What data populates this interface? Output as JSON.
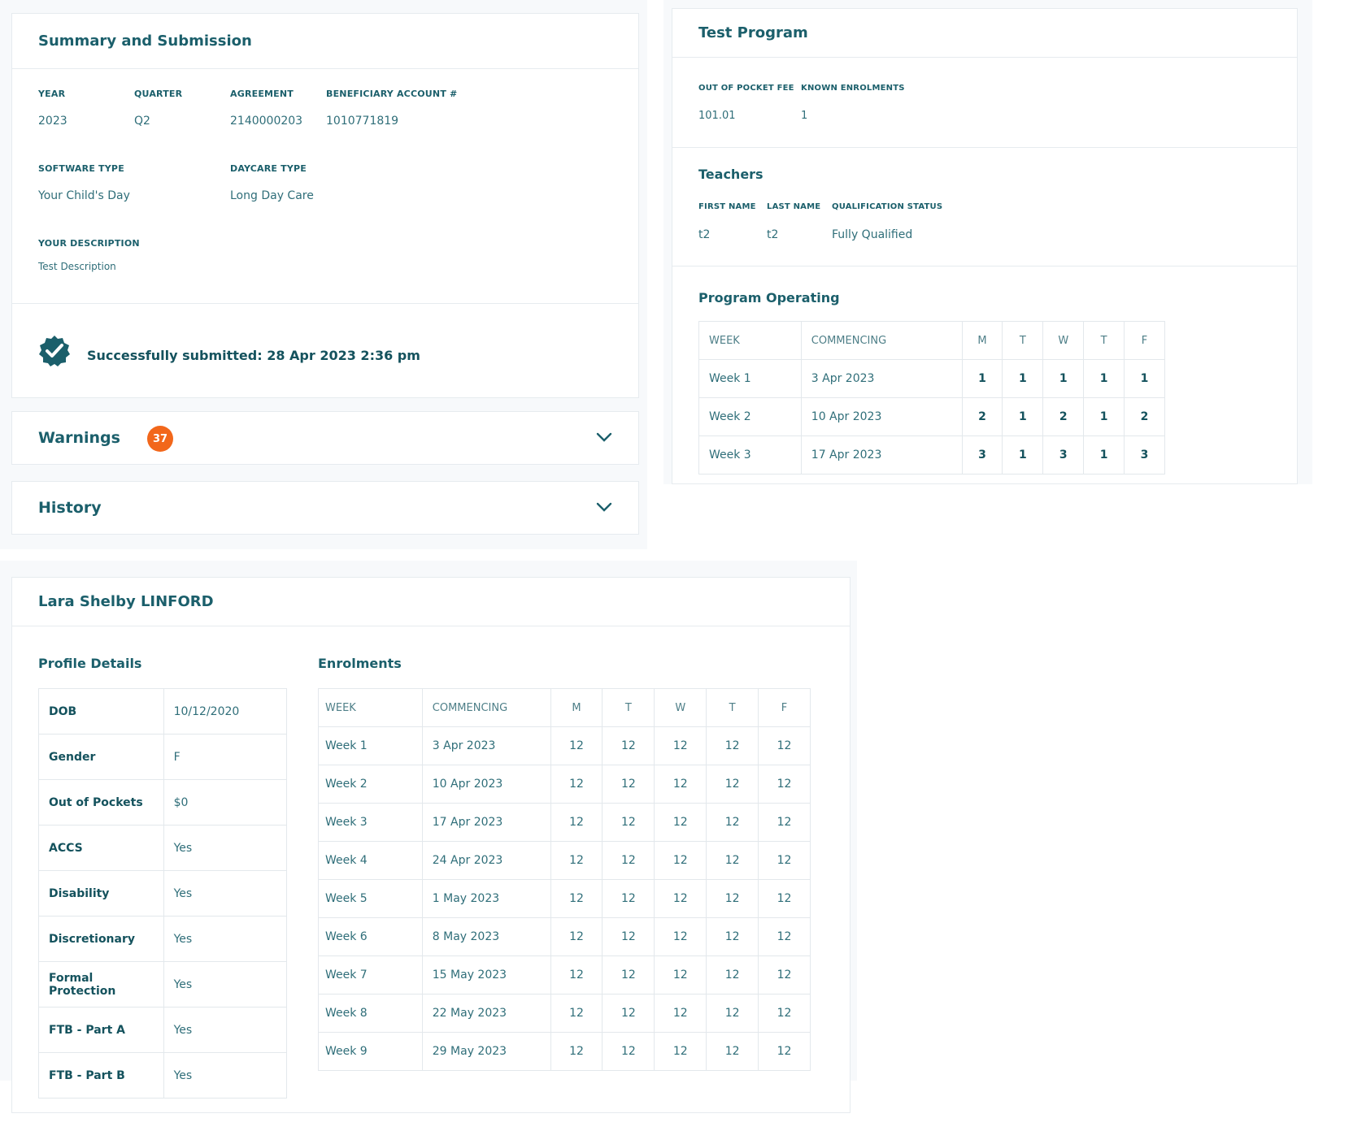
{
  "summary": {
    "title": "Summary and Submission",
    "fields": {
      "year_label": "YEAR",
      "year": "2023",
      "quarter_label": "QUARTER",
      "quarter": "Q2",
      "agreement_label": "AGREEMENT",
      "agreement": "2140000203",
      "beneficiary_label": "BENEFICIARY ACCOUNT #",
      "beneficiary": "1010771819",
      "software_label": "SOFTWARE TYPE",
      "software": "Your Child's Day",
      "daycare_label": "DAYCARE TYPE",
      "daycare": "Long Day Care",
      "description_label": "YOUR DESCRIPTION",
      "description": "Test Description"
    },
    "submitted_text": "Successfully submitted: 28 Apr 2023 2:36 pm",
    "success_icon": "verified-badge-icon"
  },
  "warnings": {
    "label": "Warnings",
    "count": "37"
  },
  "history": {
    "label": "History"
  },
  "program": {
    "title": "Test Program",
    "fee_label": "OUT OF POCKET FEE",
    "fee": "101.01",
    "enrol_label": "KNOWN ENROLMENTS",
    "enrol": "1",
    "teachers_title": "Teachers",
    "teacher_headers": [
      "FIRST NAME",
      "LAST NAME",
      "QUALIFICATION STATUS"
    ],
    "teacher": {
      "first": "t2",
      "last": "t2",
      "status": "Fully Qualified"
    },
    "operating_title": "Program Operating",
    "headers": [
      "WEEK",
      "COMMENCING",
      "M",
      "T",
      "W",
      "T",
      "F"
    ],
    "rows": [
      {
        "week": "Week 1",
        "commencing": "3 Apr 2023",
        "days": [
          "1",
          "1",
          "1",
          "1",
          "1"
        ]
      },
      {
        "week": "Week 2",
        "commencing": "10 Apr 2023",
        "days": [
          "2",
          "1",
          "2",
          "1",
          "2"
        ]
      },
      {
        "week": "Week 3",
        "commencing": "17 Apr 2023",
        "days": [
          "3",
          "1",
          "3",
          "1",
          "3"
        ]
      }
    ]
  },
  "child": {
    "name": "Lara Shelby LINFORD",
    "profile_title": "Profile Details",
    "profile": [
      {
        "k": "DOB",
        "v": "10/12/2020"
      },
      {
        "k": "Gender",
        "v": "F"
      },
      {
        "k": "Out of Pockets",
        "v": "$0"
      },
      {
        "k": "ACCS",
        "v": "Yes"
      },
      {
        "k": "Disability",
        "v": "Yes"
      },
      {
        "k": "Discretionary",
        "v": "Yes"
      },
      {
        "k": "Formal Protection",
        "v": "Yes"
      },
      {
        "k": "FTB - Part A",
        "v": "Yes"
      },
      {
        "k": "FTB - Part B",
        "v": "Yes"
      }
    ],
    "enrolments_title": "Enrolments",
    "headers": [
      "WEEK",
      "COMMENCING",
      "M",
      "T",
      "W",
      "T",
      "F"
    ],
    "rows": [
      {
        "week": "Week 1",
        "commencing": "3 Apr 2023",
        "days": [
          "12",
          "12",
          "12",
          "12",
          "12"
        ]
      },
      {
        "week": "Week 2",
        "commencing": "10 Apr 2023",
        "days": [
          "12",
          "12",
          "12",
          "12",
          "12"
        ]
      },
      {
        "week": "Week 3",
        "commencing": "17 Apr 2023",
        "days": [
          "12",
          "12",
          "12",
          "12",
          "12"
        ]
      },
      {
        "week": "Week 4",
        "commencing": "24 Apr 2023",
        "days": [
          "12",
          "12",
          "12",
          "12",
          "12"
        ]
      },
      {
        "week": "Week 5",
        "commencing": "1 May 2023",
        "days": [
          "12",
          "12",
          "12",
          "12",
          "12"
        ]
      },
      {
        "week": "Week 6",
        "commencing": "8 May 2023",
        "days": [
          "12",
          "12",
          "12",
          "12",
          "12"
        ]
      },
      {
        "week": "Week 7",
        "commencing": "15 May 2023",
        "days": [
          "12",
          "12",
          "12",
          "12",
          "12"
        ]
      },
      {
        "week": "Week 8",
        "commencing": "22 May 2023",
        "days": [
          "12",
          "12",
          "12",
          "12",
          "12"
        ]
      },
      {
        "week": "Week 9",
        "commencing": "29 May 2023",
        "days": [
          "12",
          "12",
          "12",
          "12",
          "12"
        ]
      }
    ]
  },
  "colors": {
    "brand": "#1b5f6b",
    "accent": "#f2671b",
    "border": "#e6ebef"
  }
}
